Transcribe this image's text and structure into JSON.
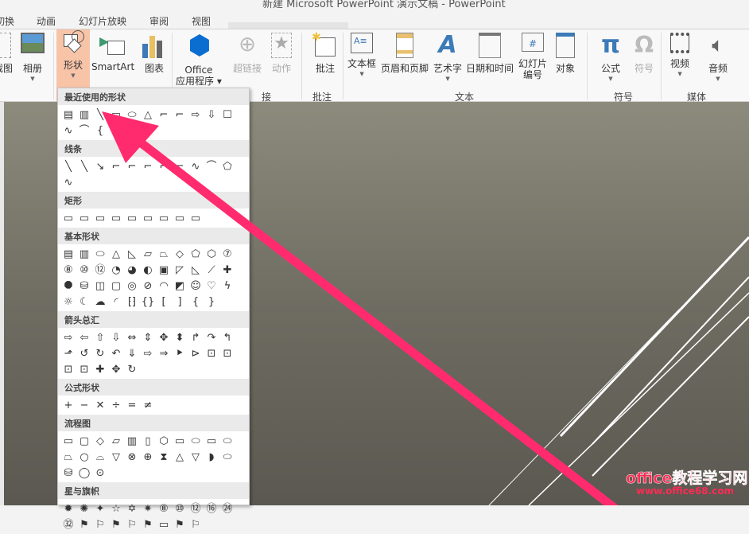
{
  "title": "新建 Microsoft PowerPoint 演示文稿 - PowerPoint",
  "tabs": [
    "切换",
    "动画",
    "幻灯片放映",
    "审阅",
    "视图"
  ],
  "ribbon": {
    "buttons": {
      "screenshot": "截图",
      "album": "相册",
      "shapes": "形状",
      "smartart": "SmartArt",
      "chart": "图表",
      "office_apps_1": "Office",
      "office_apps_2": "应用程序",
      "hyperlink": "超链接",
      "action": "动作",
      "comment": "批注",
      "textbox": "文本框",
      "header_footer": "页眉和页脚",
      "wordart": "艺术字",
      "datetime": "日期和时间",
      "slide_num_1": "幻灯片",
      "slide_num_2": "编号",
      "object": "对象",
      "equation": "公式",
      "symbol": "符号",
      "video": "视频",
      "audio": "音频"
    },
    "groups": {
      "links": "接",
      "comments": "批注",
      "text": "文本",
      "symbols": "符号",
      "media": "媒体"
    }
  },
  "shapes_menu": {
    "sections": [
      {
        "title": "最近使用的形状",
        "shapes": [
          "▤",
          "▥",
          "╲",
          "▭",
          "⬭",
          "△",
          "⌐",
          "⌐",
          "⇨",
          "⇩",
          "☐",
          "∿",
          "⌒",
          "{",
          "}"
        ]
      },
      {
        "title": "线条",
        "shapes": [
          "╲",
          "╲",
          "↘",
          "⌐",
          "⌐",
          "⌐",
          "⌐",
          "⌐",
          "∿",
          "⌒",
          "⬠",
          "∿"
        ]
      },
      {
        "title": "矩形",
        "shapes": [
          "▭",
          "▭",
          "▭",
          "▭",
          "▭",
          "▭",
          "▭",
          "▭",
          "▭"
        ]
      },
      {
        "title": "基本形状",
        "shapes": [
          "▤",
          "▥",
          "⬭",
          "△",
          "◺",
          "▱",
          "⏢",
          "◇",
          "⬠",
          "⬡",
          "⑦",
          "⑧",
          "⑩",
          "⑫",
          "◔",
          "◕",
          "◐",
          "▣",
          "◸",
          "◺",
          "⟋",
          "✚",
          "⯃",
          "⛁",
          "◫",
          "▢",
          "◎",
          "⊘",
          "◠",
          "◩",
          "☺",
          "♡",
          "ϟ",
          "☼",
          "☾",
          "☁",
          "◜",
          "⁅⁆",
          "{}",
          "[",
          "]",
          "{",
          "}"
        ]
      },
      {
        "title": "箭头总汇",
        "shapes": [
          "⇨",
          "⇦",
          "⇧",
          "⇩",
          "⇔",
          "⇕",
          "✥",
          "⬍",
          "↱",
          "↷",
          "↰",
          "⬏",
          "↺",
          "↻",
          "↶",
          "⇓",
          "⇨",
          "⇒",
          "⯈",
          "⊳",
          "⊡",
          "⊡",
          "⊡",
          "⊡",
          "✚",
          "✥",
          "↻"
        ]
      },
      {
        "title": "公式形状",
        "shapes": [
          "+",
          "−",
          "✕",
          "÷",
          "=",
          "≠"
        ]
      },
      {
        "title": "流程图",
        "shapes": [
          "▭",
          "▢",
          "◇",
          "▱",
          "▥",
          "▯",
          "⬡",
          "▭",
          "⬭",
          "▭",
          "⬭",
          "⏢",
          "○",
          "⌓",
          "▽",
          "⊗",
          "⊕",
          "⧗",
          "△",
          "▽",
          "◗",
          "⬭",
          "⛁",
          "◯",
          "⊙"
        ]
      },
      {
        "title": "星与旗帜",
        "shapes": [
          "✹",
          "✺",
          "✦",
          "☆",
          "✡",
          "✷",
          "⑧",
          "⑩",
          "⑫",
          "⑯",
          "㉔",
          "㉜",
          "⚑",
          "⚐",
          "⚑",
          "⚐",
          "⚑",
          "▭",
          "⚑",
          "⚐"
        ]
      }
    ]
  },
  "watermark": {
    "line1": "office教程学习网",
    "line2": "www.office68.com"
  },
  "colors": {
    "arrow": "#ff2b6e",
    "shapes_active": "#f8c4a8"
  }
}
